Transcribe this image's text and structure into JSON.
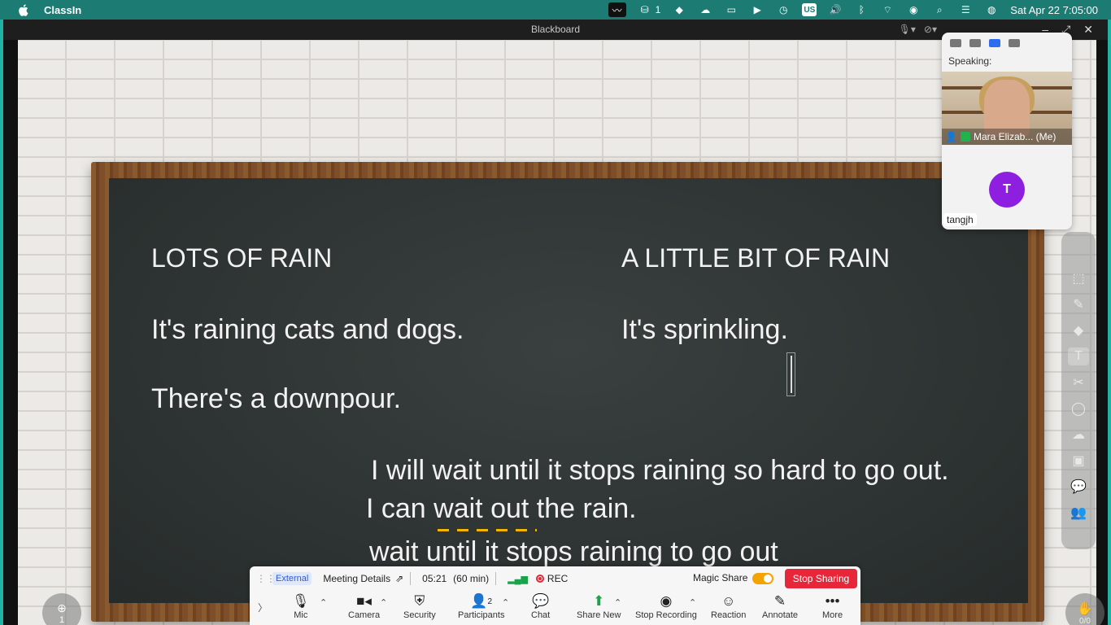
{
  "menubar": {
    "app_name": "ClassIn",
    "notification_count": "1",
    "input_source": "US",
    "datetime": "Sat Apr 22  7:05:00"
  },
  "window": {
    "title": "Blackboard"
  },
  "board": {
    "heading_left": "LOTS OF RAIN",
    "heading_right": "A LITTLE BIT OF RAIN",
    "line_left_1": "It's raining cats and dogs.",
    "line_left_2": "There's a downpour.",
    "line_right_1": "It's sprinkling.",
    "line_center_1": "I will wait until it stops raining so hard to go out.",
    "line_center_2": "I can wait out the rain.",
    "line_center_3": "wait until it stops raining to go out",
    "underline_color": "#f5b400"
  },
  "video_panel": {
    "speaking_label": "Speaking:",
    "self_name": "Mara Elizab...  (Me)",
    "participant_initial": "T",
    "participant_name": "tangjh",
    "avatar_color": "#8e1fe0"
  },
  "left_button": {
    "label": "1"
  },
  "right_button": {
    "label": "0/0"
  },
  "meeting_bar": {
    "badge": "External",
    "details": "Meeting Details",
    "elapsed": "05:21",
    "duration": "(60 min)",
    "rec": "REC",
    "magic_share": "Magic Share",
    "stop_sharing": "Stop Sharing",
    "participants_count": "2",
    "buttons": {
      "mic": "Mic",
      "camera": "Camera",
      "security": "Security",
      "participants": "Participants",
      "chat": "Chat",
      "share_new": "Share New",
      "stop_recording": "Stop Recording",
      "reaction": "Reaction",
      "annotate": "Annotate",
      "more": "More"
    }
  },
  "colors": {
    "menubar": "#1c7c74",
    "accent_teal": "#1fb3a6",
    "stop_red": "#e8263a",
    "chalkboard": "#2f3534"
  }
}
